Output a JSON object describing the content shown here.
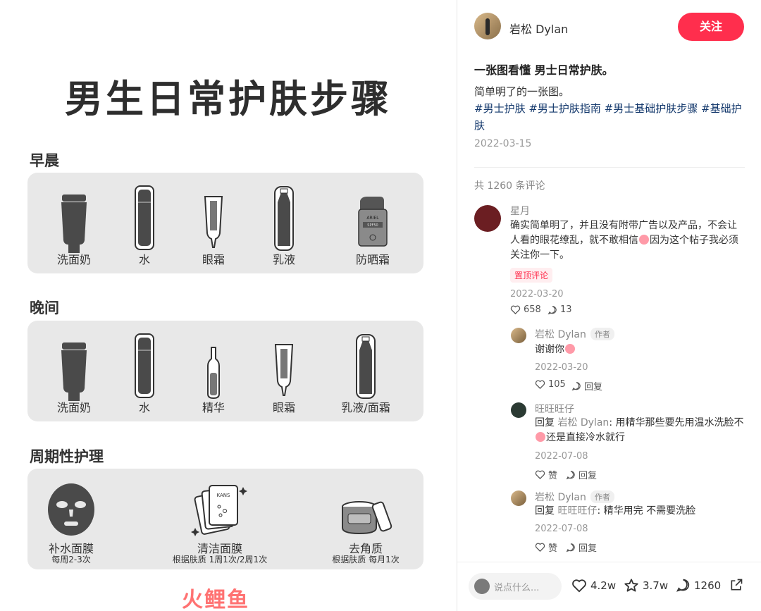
{
  "poster": {
    "title": "男生日常护肤步骤",
    "sections": [
      {
        "heading": "早晨",
        "items": [
          "洗面奶",
          "水",
          "眼霜",
          "乳液",
          "防晒霜"
        ]
      },
      {
        "heading": "晚间",
        "items": [
          "洗面奶",
          "水",
          "精华",
          "眼霜",
          "乳液/面霜"
        ]
      },
      {
        "heading": "周期性护理",
        "items": [
          {
            "label": "补水面膜",
            "sub": "每周2-3次"
          },
          {
            "label": "清洁面膜",
            "sub": "根据肤质 1周1次/2周1次"
          },
          {
            "label": "去角质",
            "sub": "根据肤质 每月1次"
          }
        ]
      }
    ],
    "product_texts": {
      "sunscreen": "ARIEL",
      "sunscreen_sub": "SPF50",
      "mask_pack": "KANS"
    }
  },
  "author": {
    "name": "岩松 Dylan",
    "follow_label": "关注"
  },
  "post": {
    "title": "一张图看懂 男士日常护肤。",
    "desc": "简单明了的一张图。",
    "hashtags": "#男士护肤 #男士护肤指南 #男士基础护肤步骤 #基础护肤",
    "date": "2022-03-15",
    "comment_count": "共 1260 条评论"
  },
  "comments": [
    {
      "name": "星月",
      "text_a": "确实简单明了，并且没有附带广告以及产品，不会让人看的眼花缭乱，就不敢相信",
      "text_b": "因为这个帖子我必须关注你一下。",
      "pin": "置顶评论",
      "date": "2022-03-20",
      "likes": "658",
      "replies": "13"
    }
  ],
  "replies": [
    {
      "name": "岩松 Dylan",
      "tag": "作者",
      "text": "谢谢你",
      "date": "2022-03-20",
      "likes": "105",
      "reply_label": "回复"
    },
    {
      "name": "旺旺旺仔",
      "prefix": "回复",
      "to": "岩松 Dylan",
      "text": ": 用精华那些要先用温水洗脸不",
      "text_b": "还是直接冷水就行",
      "date": "2022-07-08",
      "likes": "赞",
      "reply_label": "回复"
    },
    {
      "name": "岩松 Dylan",
      "tag": "作者",
      "prefix": "回复",
      "to": "旺旺旺仔",
      "text": ": 精华用完 不需要洗脸",
      "date": "2022-07-08",
      "likes": "赞",
      "reply_label": "回复"
    }
  ],
  "bottom": {
    "input_placeholder": "说点什么...",
    "likes": "4.2w",
    "stars": "3.7w",
    "comments": "1260"
  },
  "watermark": "火鲤鱼",
  "colors": {
    "accent": "#ff2e4d",
    "hashtag": "#13386c",
    "card": "#e8e8e8"
  }
}
